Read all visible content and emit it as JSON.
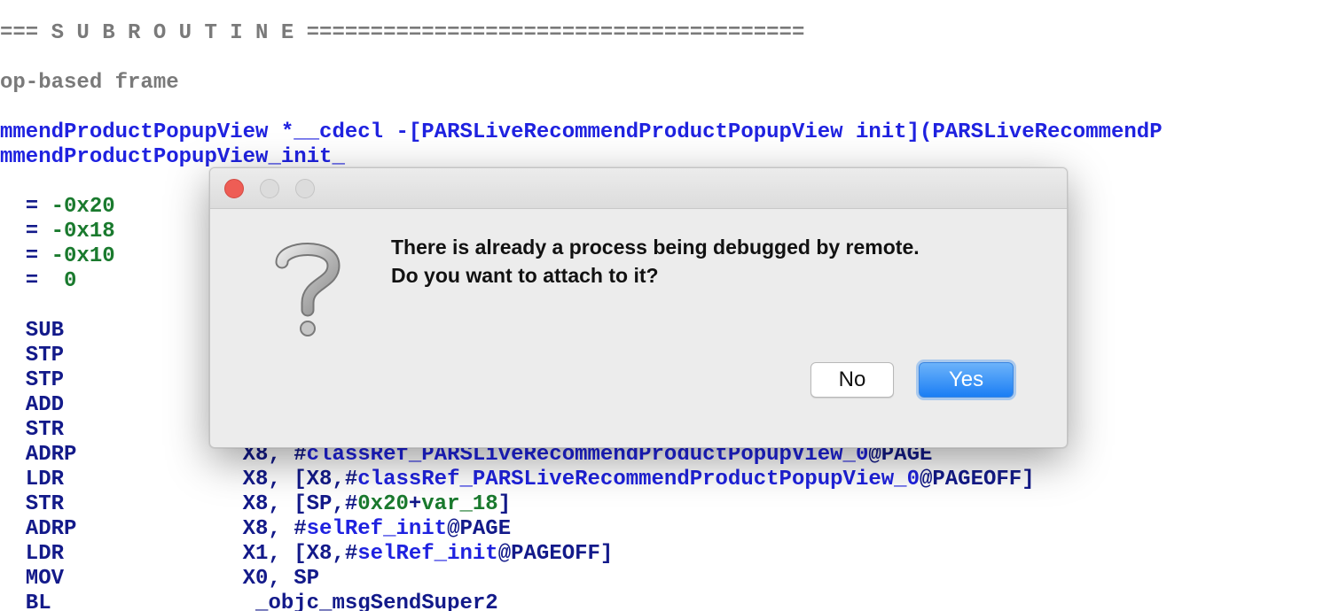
{
  "listing": {
    "lines": [
      {
        "segments": [
          {
            "text": "=== S U B R O U T I N E =======================================",
            "color": "gray"
          }
        ]
      },
      {
        "segments": [
          {
            "text": "op-based frame",
            "color": "gray"
          }
        ]
      },
      {
        "segments": [
          {
            "text": "mmendProductPopupView *__cdecl -[PARSLiveRecommendProductPopupView init](PARSLiveRecommendP",
            "color": "blue"
          }
        ]
      },
      {
        "segments": [
          {
            "text": "mmendProductPopupView_init_",
            "color": "blue"
          }
        ]
      },
      {
        "segments": [
          {
            "text": "  = ",
            "color": "navy"
          },
          {
            "text": "-0x20",
            "color": "green"
          }
        ]
      },
      {
        "segments": [
          {
            "text": "  = ",
            "color": "navy"
          },
          {
            "text": "-0x18",
            "color": "green"
          }
        ]
      },
      {
        "segments": [
          {
            "text": "  = ",
            "color": "navy"
          },
          {
            "text": "-0x10",
            "color": "green"
          }
        ]
      },
      {
        "segments": [
          {
            "text": "  =  ",
            "color": "navy"
          },
          {
            "text": "0",
            "color": "green"
          }
        ]
      },
      {
        "segments": [
          {
            "text": "  SUB",
            "color": "navy"
          }
        ]
      },
      {
        "segments": [
          {
            "text": "  STP",
            "color": "navy"
          }
        ]
      },
      {
        "segments": [
          {
            "text": "  STP",
            "color": "navy"
          }
        ]
      },
      {
        "segments": [
          {
            "text": "  ADD",
            "color": "navy"
          }
        ]
      },
      {
        "segments": [
          {
            "text": "  STR",
            "color": "navy"
          }
        ]
      },
      {
        "segments": [
          {
            "text": "  ADRP             X8, #",
            "color": "navy"
          },
          {
            "text": "classRef_PARSLiveRecommendProductPopupView_0",
            "color": "blue"
          },
          {
            "text": "@PAGE",
            "color": "navy"
          }
        ]
      },
      {
        "segments": [
          {
            "text": "  LDR              X8, [X8,#",
            "color": "navy"
          },
          {
            "text": "classRef_PARSLiveRecommendProductPopupView_0",
            "color": "blue"
          },
          {
            "text": "@PAGEOFF]",
            "color": "navy"
          }
        ]
      },
      {
        "segments": [
          {
            "text": "  STR              X8, [SP,#",
            "color": "navy"
          },
          {
            "text": "0x20",
            "color": "green"
          },
          {
            "text": "+",
            "color": "navy"
          },
          {
            "text": "var_18",
            "color": "green"
          },
          {
            "text": "]",
            "color": "navy"
          }
        ]
      },
      {
        "segments": [
          {
            "text": "  ADRP             X8, #",
            "color": "navy"
          },
          {
            "text": "selRef_init",
            "color": "blue"
          },
          {
            "text": "@PAGE",
            "color": "navy"
          }
        ]
      },
      {
        "segments": [
          {
            "text": "  LDR              X1, [X8,#",
            "color": "navy"
          },
          {
            "text": "selRef_init",
            "color": "blue"
          },
          {
            "text": "@PAGEOFF]",
            "color": "navy"
          }
        ]
      },
      {
        "segments": [
          {
            "text": "  MOV              X0, SP",
            "color": "navy"
          }
        ]
      },
      {
        "segments": [
          {
            "text": "  BL                ",
            "color": "navy"
          },
          {
            "text": "_objc_msgSendSuper2",
            "color": "navy"
          }
        ]
      }
    ]
  },
  "dialog": {
    "message_line1": "There is already a process being debugged by remote.",
    "message_line2": "Do you want to attach to it?",
    "no_label": "No",
    "yes_label": "Yes",
    "icon": "question-mark-icon",
    "accent_color": "#1b7ef4",
    "close_color": "#ee5d55"
  }
}
